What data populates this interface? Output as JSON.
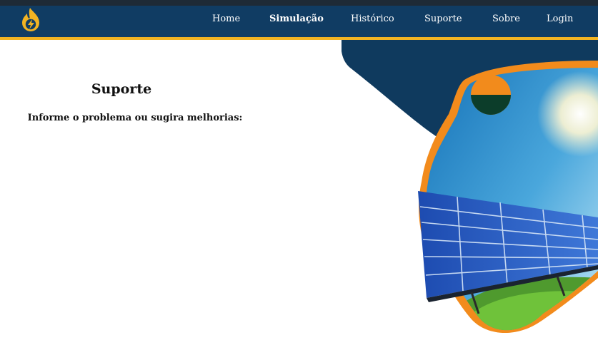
{
  "nav": {
    "items": [
      {
        "label": "Home"
      },
      {
        "label": "Simulação"
      },
      {
        "label": "Histórico"
      },
      {
        "label": "Suporte"
      },
      {
        "label": "Sobre"
      },
      {
        "label": "Login"
      }
    ]
  },
  "main": {
    "title": "Suporte",
    "prompt": "Informe o problema ou sugira melhorias:"
  },
  "colors": {
    "navbar": "#103c63",
    "accent": "#f2b322",
    "orange": "#f28b1c",
    "panel": "#0f3a5e"
  },
  "icons": {
    "logo": "flame-lightning-logo"
  }
}
